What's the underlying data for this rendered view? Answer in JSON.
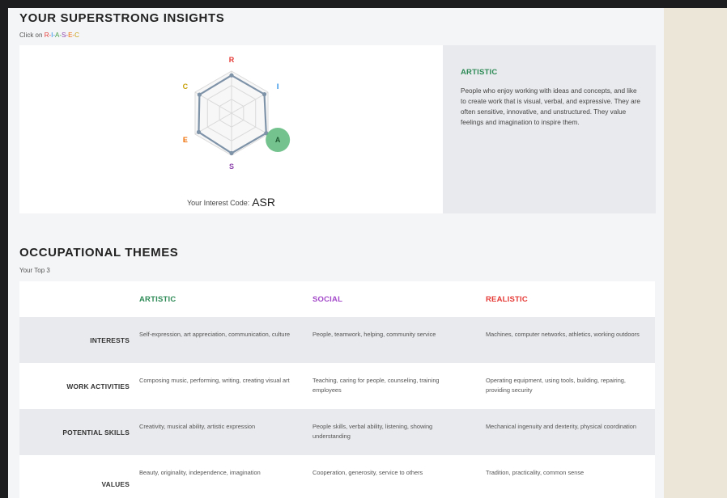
{
  "colors": {
    "R": "#e53935",
    "I": "#1e88e5",
    "A": "#43a047",
    "S": "#8e44ad",
    "E": "#ef6c00",
    "C": "#c9a20c",
    "accent_green": "#2e8b57",
    "accent_purple": "#a349c9",
    "accent_red": "#e53935"
  },
  "insights": {
    "title": "YOUR SUPERSTRONG INSIGHTS",
    "click_prefix": "Click on ",
    "riasec": [
      {
        "letter": "R",
        "sep": "-"
      },
      {
        "letter": "I",
        "sep": "-"
      },
      {
        "letter": "A",
        "sep": "-"
      },
      {
        "letter": "S",
        "sep": "-"
      },
      {
        "letter": "E",
        "sep": "-"
      },
      {
        "letter": "C",
        "sep": ""
      }
    ],
    "interest_code_label": "Your Interest Code:",
    "interest_code": "ASR",
    "selected_letter": "A",
    "radar_values": {
      "R": 0.9,
      "I": 0.9,
      "A": 0.95,
      "S": 0.95,
      "E": 0.9,
      "C": 0.88
    }
  },
  "description": {
    "title": "ARTISTIC",
    "text": "People who enjoy working with ideas and concepts, and like to create work that is visual, verbal, and expressive. They are often sensitive, innovative, and unstructured. They value feelings and imagination to inspire them."
  },
  "themes": {
    "title": "OCCUPATIONAL THEMES",
    "subtitle": "Your Top 3",
    "columns": [
      {
        "label": "ARTISTIC",
        "color": "#2e8b57"
      },
      {
        "label": "SOCIAL",
        "color": "#a349c9"
      },
      {
        "label": "REALISTIC",
        "color": "#e53935"
      }
    ],
    "rows": [
      {
        "label": "INTERESTS",
        "cells": [
          "Self-expression, art appreciation, communication, culture",
          "People, teamwork, helping, community service",
          "Machines, computer networks, athletics, working outdoors"
        ]
      },
      {
        "label": "WORK ACTIVITIES",
        "cells": [
          "Composing music, performing, writing, creating visual art",
          "Teaching, caring for people, counseling, training employees",
          "Operating equipment, using tools, building, repairing, providing security"
        ]
      },
      {
        "label": "POTENTIAL SKILLS",
        "cells": [
          "Creativity, musical ability, artistic expression",
          "People skills, verbal ability, listening, showing understanding",
          "Mechanical ingenuity and dexterity, physical coordination"
        ]
      },
      {
        "label": "VALUES",
        "cells": [
          "Beauty, originality, independence, imagination",
          "Cooperation, generosity, service to others",
          "Tradition, practicality, common sense"
        ]
      }
    ]
  }
}
